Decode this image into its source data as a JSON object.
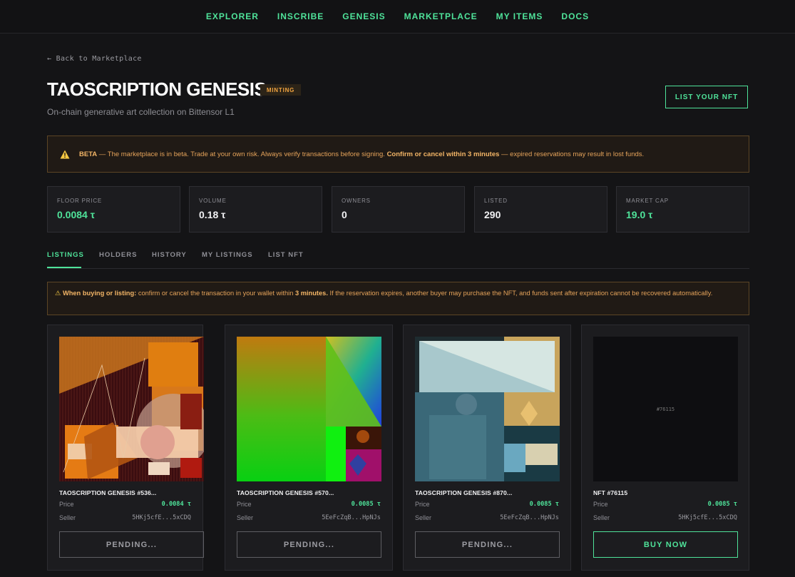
{
  "nav": {
    "items": [
      "EXPLORER",
      "INSCRIBE",
      "GENESIS",
      "MARKETPLACE",
      "MY ITEMS",
      "DOCS"
    ]
  },
  "header": {
    "back_label": "← Back to Marketplace",
    "title": "TAOSCRIPTION GENESIS",
    "badge": "MINTING",
    "subtitle": "On-chain generative art collection on Bittensor L1",
    "list_button": "LIST YOUR NFT"
  },
  "beta_banner": {
    "label": "BETA",
    "text1": " — The marketplace is in beta. Trade at your own risk. Always verify transactions before signing. ",
    "emphasis": "Confirm or cancel within 3 minutes",
    "text2": " — expired reservations may result in lost funds."
  },
  "stats": [
    {
      "label": "FLOOR PRICE",
      "value": "0.0084 τ",
      "accent": true
    },
    {
      "label": "VOLUME",
      "value": "0.18 τ",
      "accent": false
    },
    {
      "label": "OWNERS",
      "value": "0",
      "accent": false
    },
    {
      "label": "LISTED",
      "value": "290",
      "accent": false
    },
    {
      "label": "MARKET CAP",
      "value": "19.0 τ",
      "accent": true
    }
  ],
  "tabs": [
    {
      "label": "LISTINGS",
      "active": true
    },
    {
      "label": "HOLDERS",
      "active": false
    },
    {
      "label": "HISTORY",
      "active": false
    },
    {
      "label": "MY LISTINGS",
      "active": false
    },
    {
      "label": "LIST NFT",
      "active": false
    }
  ],
  "notice": {
    "icon": "⚠",
    "lead": "When buying or listing:",
    "text1": " confirm or cancel the transaction in your wallet within ",
    "emphasis": "3 minutes.",
    "text2": " If the reservation expires, another buyer may purchase the NFT, and funds sent after expiration cannot be recovered automatically."
  },
  "listing_labels": {
    "price": "Price",
    "seller": "Seller"
  },
  "listings": [
    {
      "name": "TAOSCRIPTION GENESIS #536...",
      "price": "0.0084 τ",
      "seller": "5HKj5cfE...5xCDQ",
      "button": "PENDING...",
      "art": "abstract-orange"
    },
    {
      "name": "TAOSCRIPTION GENESIS #570...",
      "price": "0.0085 τ",
      "seller": "5EeFcZqB...HpNJs",
      "button": "PENDING...",
      "art": "abstract-green"
    },
    {
      "name": "TAOSCRIPTION GENESIS #870...",
      "price": "0.0085 τ",
      "seller": "5EeFcZqB...HpNJs",
      "button": "PENDING...",
      "art": "abstract-teal"
    },
    {
      "name": "NFT #76115",
      "price": "0.0085 τ",
      "seller": "5HKj5cfE...5xCDQ",
      "button": "BUY NOW",
      "art_label": "#76115"
    }
  ],
  "colors": {
    "accent": "#4fe39a",
    "warning": "#e5a35a",
    "background": "#141416"
  }
}
